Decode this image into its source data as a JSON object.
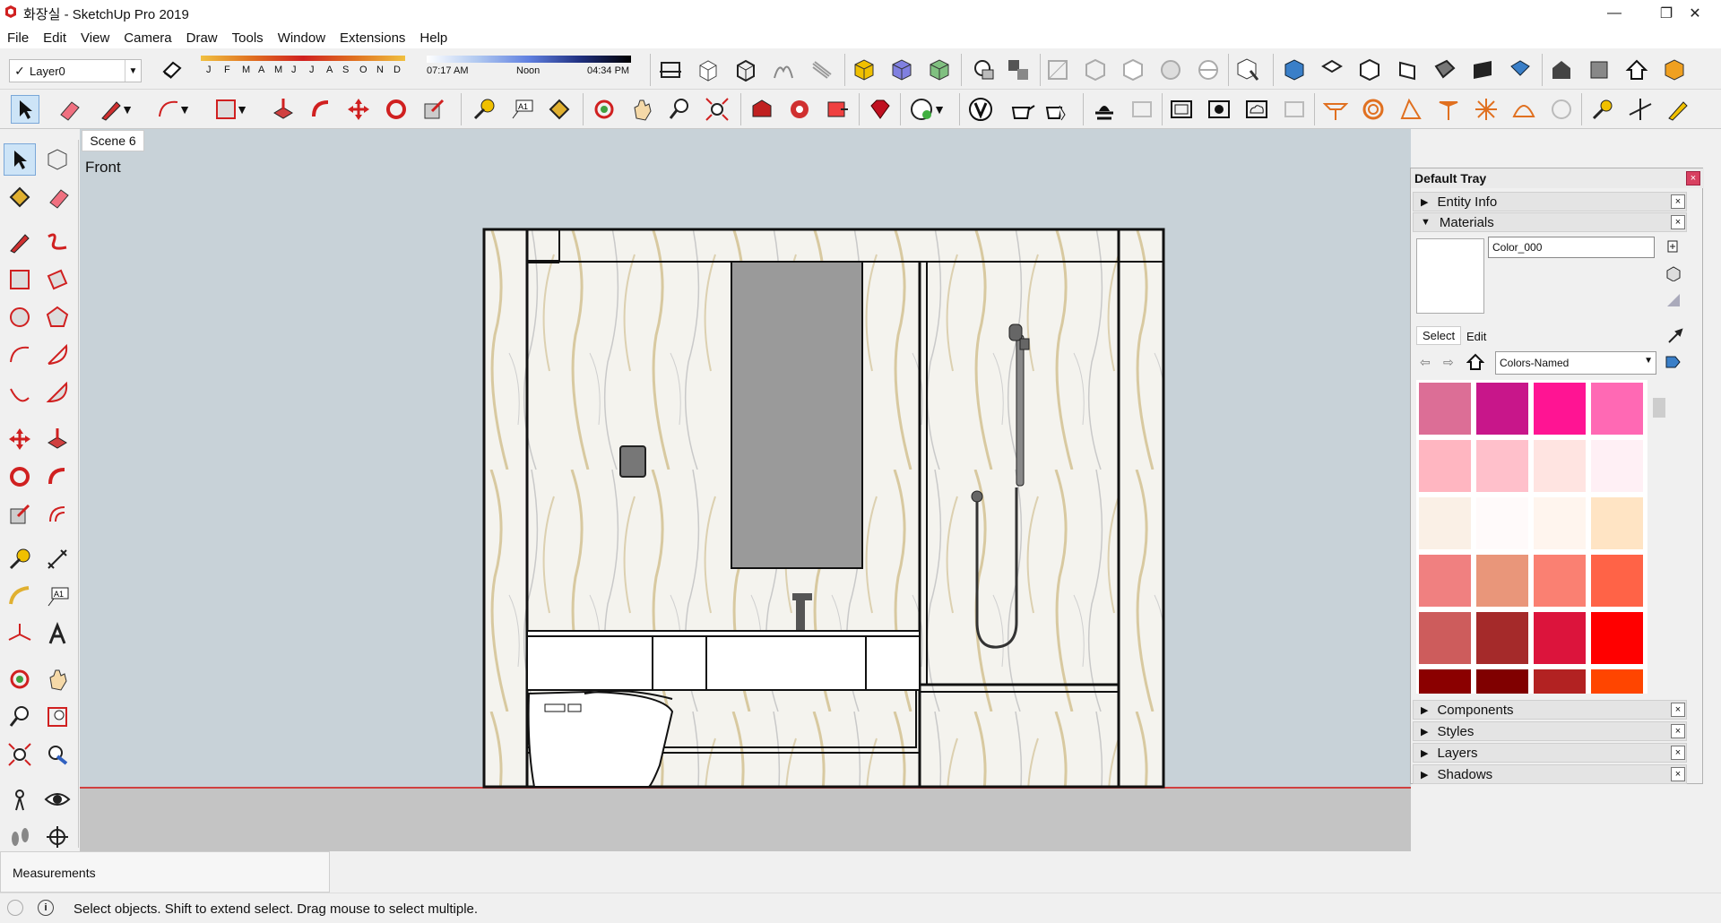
{
  "window": {
    "title": "화장실 - SketchUp Pro 2019",
    "minimize": "—",
    "restore": "❐",
    "close": "✕"
  },
  "menu": [
    "File",
    "Edit",
    "View",
    "Camera",
    "Draw",
    "Tools",
    "Window",
    "Extensions",
    "Help"
  ],
  "layer": {
    "current": "Layer0",
    "check": "✓"
  },
  "shadows": {
    "months": [
      "J",
      "F",
      "M",
      "A",
      "M",
      "J",
      "J",
      "A",
      "S",
      "O",
      "N",
      "D"
    ],
    "time_start": "07:17 AM",
    "time_mid": "Noon",
    "time_end": "04:34 PM"
  },
  "viewport": {
    "scene_tab": "Scene 6",
    "view_name": "Front"
  },
  "tray": {
    "title": "Default Tray",
    "close": "×",
    "sections_top": [
      {
        "label": "Entity Info",
        "expanded": false
      },
      {
        "label": "Materials",
        "expanded": true
      }
    ],
    "materials": {
      "name": "Color_000",
      "select_tab": "Select",
      "edit_tab": "Edit",
      "library": "Colors-Named",
      "swatches": [
        "#dc6e96",
        "#c8168a",
        "#ff1493",
        "#ff69b4",
        "#ffb6c1",
        "#ffc0cb",
        "#ffe4e1",
        "#fff0f5",
        "#faf0e6",
        "#fffafa",
        "#fff5ee",
        "#ffe4c4",
        "#f08080",
        "#e9967a",
        "#fa8072",
        "#ff6347",
        "#cd5c5c",
        "#a52a2a",
        "#dc143c",
        "#ff0000",
        "#8b0000",
        "#800000",
        "#b22222",
        "#ff4500"
      ]
    },
    "sections_bottom": [
      {
        "label": "Components"
      },
      {
        "label": "Styles"
      },
      {
        "label": "Layers"
      },
      {
        "label": "Shadows"
      }
    ]
  },
  "status": {
    "measurements_label": "Measurements",
    "message": "Select objects. Shift to extend select. Drag mouse to select multiple.",
    "info_icon": "i"
  },
  "icons": {
    "toolbar_top": [
      "eraser-style-icon",
      "blank",
      "blank",
      "blank",
      "blank",
      "blank",
      "blank",
      "section-plane-icon",
      "box-icon",
      "box-open-icon",
      "sandbox-icon",
      "drape-icon",
      "paint-box-icon",
      "color-box-icon",
      "texture-box-icon",
      "ball-icon",
      "group-icon",
      "xray-icon",
      "wireframe-icon",
      "hidden-line-icon",
      "shaded-icon",
      "monochrome-icon",
      "component-icon",
      "iso-view-icon",
      "top-view-icon",
      "front-view-icon",
      "right-view-icon",
      "back-view-icon",
      "left-view-icon",
      "bottom-view-icon",
      "warehouse-icon",
      "extension-icon",
      "house-icon",
      "pack-icon"
    ],
    "toolbar_main": [
      "select-icon",
      "eraser-icon",
      "pencil-icon",
      "arc-icon",
      "rectangle-icon",
      "push-pull-icon",
      "follow-me-icon",
      "move-icon",
      "rotate-icon",
      "scale-icon",
      "tape-measure-icon",
      "text-icon",
      "paint-bucket-icon",
      "orbit-icon",
      "pan-icon",
      "zoom-icon",
      "zoom-extents-icon",
      "warehouse-icon",
      "extension-warehouse-icon",
      "layout-icon",
      "ruby-icon",
      "profile-icon",
      "vray-icon",
      "teapot-icon",
      "hand-icon",
      "render-icon",
      "frame-icon",
      "camera-icon",
      "cloud-icon",
      "lock-icon",
      "table-icon",
      "ring-icon",
      "angle-icon",
      "lamp-icon",
      "burst-icon",
      "dome-icon",
      "sphere-icon",
      "pin-icon",
      "axes-icon",
      "pencil-small-icon"
    ]
  }
}
